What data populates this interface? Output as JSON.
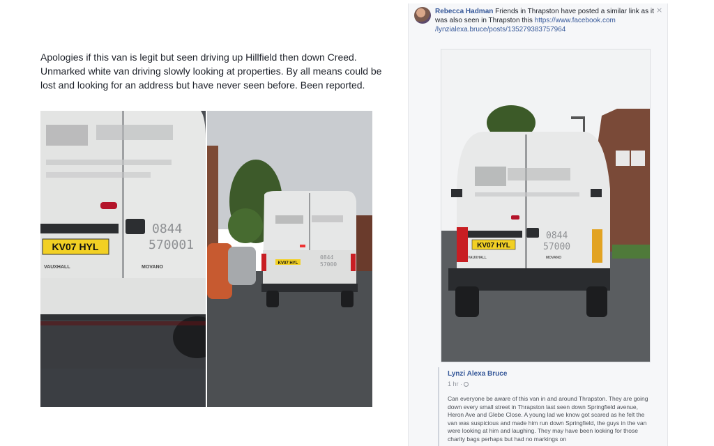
{
  "post": {
    "text": "Apologies if this van is legit but seen driving up Hillfield then down Creed. Unmarked white van driving slowly looking at properties. By all means could be lost and looking for an address but have never seen before. Been reported.",
    "photos": [
      {
        "alt": "Close-up of the rear of a white van",
        "plate": "KV07 HYL",
        "rear_text": "0844 570001",
        "brand": "VAUXHALL",
        "model": "MOVANO"
      },
      {
        "alt": "White van driving down a residential street",
        "plate": "KV07 HYL",
        "rear_text": "0844 57000"
      }
    ]
  },
  "comment": {
    "author": "Rebecca Hadman",
    "text": "Friends in Thrapston have posted a similar link as it was also seen in Thrapston this",
    "link": "https://www.facebook.com/lynzialexa.bruce/posts/1352793837579​64",
    "link_line1": "https://www.facebook.com",
    "link_line2": "/lynzialexa.bruce/posts/135279383757964",
    "close_glyph": "×"
  },
  "shared_photo": {
    "alt": "Rear of white van parked on street",
    "plate": "KV07 HYL",
    "rear_text": "0844 57000",
    "brand": "VAUXHALL",
    "model": "MOVANO"
  },
  "shared_post": {
    "author": "Lynzi Alexa Bruce",
    "time": "1 hr ·",
    "text": "Can everyone be aware of this van in and around Thrapston. They are going down every small street in Thrapston last seen down Springfield avenue, Heron Ave and Glebe Close. A young lad we know got scared as he felt the van was suspicious and made him run down Springfield, the guys in the van were looking at him and laughing. They may have been looking for those charity bags perhaps but had no markings on"
  },
  "colors": {
    "link": "#365899",
    "plate_yellow": "#f2d024",
    "van_white": "#e9eaea"
  }
}
